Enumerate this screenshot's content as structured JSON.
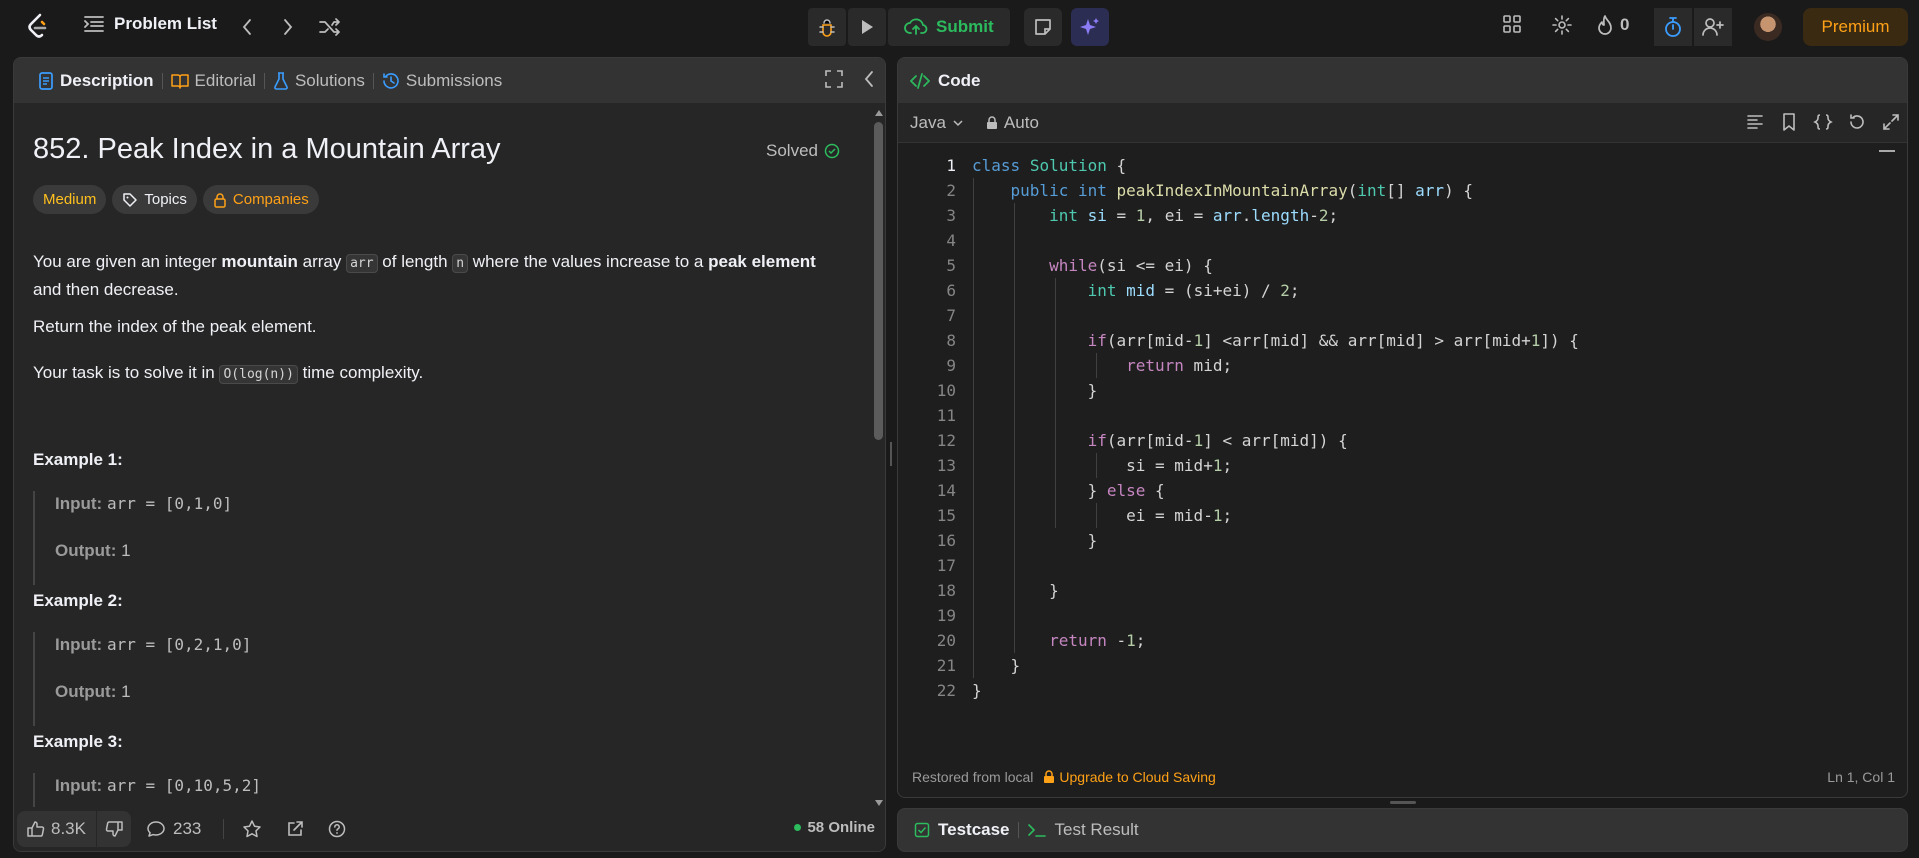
{
  "topbar": {
    "problem_list_label": "Problem List",
    "submit_label": "Submit",
    "streak_count": "0",
    "premium_label": "Premium"
  },
  "left": {
    "tabs": [
      {
        "label": "Description",
        "icon": "description-icon"
      },
      {
        "label": "Editorial",
        "icon": "book-icon"
      },
      {
        "label": "Solutions",
        "icon": "flask-icon"
      },
      {
        "label": "Submissions",
        "icon": "history-icon"
      }
    ],
    "title": "852. Peak Index in a Mountain Array",
    "status": "Solved",
    "tags": {
      "difficulty": "Medium",
      "topics": "Topics",
      "companies": "Companies"
    },
    "desc": {
      "p1_a": "You are given an integer ",
      "p1_b": "mountain",
      "p1_c": " array ",
      "p1_code1": "arr",
      "p1_d": " of length ",
      "p1_code2": "n",
      "p1_e": " where the values increase to a ",
      "p1_f": "peak element",
      "p1_g": " and then decrease.",
      "p2": "Return the index of the peak element.",
      "p3_a": "Your task is to solve it in ",
      "p3_code": "O(log(n))",
      "p3_b": " time complexity."
    },
    "examples": [
      {
        "title": "Example 1:",
        "input_label": "Input:",
        "input": "arr = [0,1,0]",
        "output_label": "Output:",
        "output": "1"
      },
      {
        "title": "Example 2:",
        "input_label": "Input:",
        "input": "arr = [0,2,1,0]",
        "output_label": "Output:",
        "output": "1"
      },
      {
        "title": "Example 3:",
        "input_label": "Input:",
        "input": "arr = [0,10,5,2]"
      }
    ],
    "footer": {
      "likes": "8.3K",
      "comments": "233",
      "online": "58 Online"
    }
  },
  "code": {
    "header": "Code",
    "language": "Java",
    "mode": "Auto",
    "restored": "Restored from local",
    "upgrade": "Upgrade to Cloud Saving",
    "cursor": "Ln 1, Col 1",
    "line_numbers": [
      "1",
      "2",
      "3",
      "4",
      "5",
      "6",
      "7",
      "8",
      "9",
      "10",
      "11",
      "12",
      "13",
      "14",
      "15",
      "16",
      "17",
      "18",
      "19",
      "20",
      "21",
      "22"
    ]
  },
  "test": {
    "testcase": "Testcase",
    "result": "Test Result"
  },
  "colors": {
    "accent": "#ffa116",
    "green": "#2cbb5d",
    "medium": "#ffc01e",
    "bg": "#1a1a1a"
  }
}
